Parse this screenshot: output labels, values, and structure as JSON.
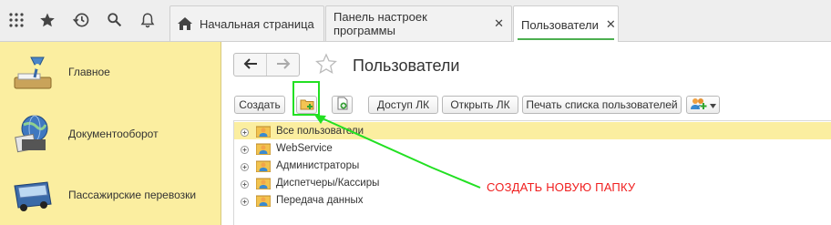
{
  "topbar": {
    "icons": [
      "apps-grid-icon",
      "star-icon",
      "history-icon",
      "search-icon",
      "bell-icon"
    ],
    "tabs": [
      {
        "label": "Начальная страница",
        "icon": "home-icon",
        "closable": false,
        "active": false
      },
      {
        "label": "Панель настроек программы",
        "closable": true,
        "active": false
      },
      {
        "label": "Пользователи",
        "closable": true,
        "active": true
      }
    ],
    "close_glyph": "✕"
  },
  "sidebar": {
    "items": [
      {
        "label": "Главное",
        "icon": "desk-lamp-icon"
      },
      {
        "label": "Документооборот",
        "icon": "globe-documents-icon"
      },
      {
        "label": "Пассажирские перевозки",
        "icon": "bus-icon"
      }
    ]
  },
  "main": {
    "title": "Пользователи",
    "toolbar": {
      "create_label": "Создать",
      "create_folder_icon": "new-folder-icon",
      "copy_icon": "add-document-icon",
      "access_label": "Доступ ЛК",
      "open_label": "Открыть ЛК",
      "print_label": "Печать списка пользователей",
      "users_menu_icon": "users-add-icon"
    },
    "tree": [
      {
        "label": "Все пользователи",
        "selected": true
      },
      {
        "label": "WebService",
        "selected": false
      },
      {
        "label": "Администраторы",
        "selected": false
      },
      {
        "label": "Диспетчеры/Кассиры",
        "selected": false
      },
      {
        "label": "Передача данных",
        "selected": false
      }
    ]
  },
  "annotation": {
    "text": "СОЗДАТЬ НОВУЮ ПАПКУ",
    "color": "#f01e1e",
    "arrow_color": "#22e022"
  },
  "colors": {
    "sidebar_bg": "#fbeea0",
    "selected_row": "#fbeea0",
    "active_tab_underline": "#4caf50"
  }
}
